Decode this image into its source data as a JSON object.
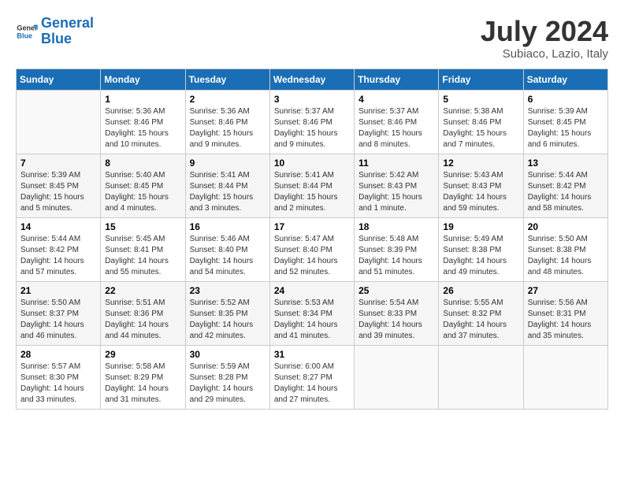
{
  "header": {
    "logo_line1": "General",
    "logo_line2": "Blue",
    "month_title": "July 2024",
    "location": "Subiaco, Lazio, Italy"
  },
  "columns": [
    "Sunday",
    "Monday",
    "Tuesday",
    "Wednesday",
    "Thursday",
    "Friday",
    "Saturday"
  ],
  "weeks": [
    [
      {
        "day": "",
        "sunrise": "",
        "sunset": "",
        "daylight": ""
      },
      {
        "day": "1",
        "sunrise": "Sunrise: 5:36 AM",
        "sunset": "Sunset: 8:46 PM",
        "daylight": "Daylight: 15 hours and 10 minutes."
      },
      {
        "day": "2",
        "sunrise": "Sunrise: 5:36 AM",
        "sunset": "Sunset: 8:46 PM",
        "daylight": "Daylight: 15 hours and 9 minutes."
      },
      {
        "day": "3",
        "sunrise": "Sunrise: 5:37 AM",
        "sunset": "Sunset: 8:46 PM",
        "daylight": "Daylight: 15 hours and 9 minutes."
      },
      {
        "day": "4",
        "sunrise": "Sunrise: 5:37 AM",
        "sunset": "Sunset: 8:46 PM",
        "daylight": "Daylight: 15 hours and 8 minutes."
      },
      {
        "day": "5",
        "sunrise": "Sunrise: 5:38 AM",
        "sunset": "Sunset: 8:46 PM",
        "daylight": "Daylight: 15 hours and 7 minutes."
      },
      {
        "day": "6",
        "sunrise": "Sunrise: 5:39 AM",
        "sunset": "Sunset: 8:45 PM",
        "daylight": "Daylight: 15 hours and 6 minutes."
      }
    ],
    [
      {
        "day": "7",
        "sunrise": "Sunrise: 5:39 AM",
        "sunset": "Sunset: 8:45 PM",
        "daylight": "Daylight: 15 hours and 5 minutes."
      },
      {
        "day": "8",
        "sunrise": "Sunrise: 5:40 AM",
        "sunset": "Sunset: 8:45 PM",
        "daylight": "Daylight: 15 hours and 4 minutes."
      },
      {
        "day": "9",
        "sunrise": "Sunrise: 5:41 AM",
        "sunset": "Sunset: 8:44 PM",
        "daylight": "Daylight: 15 hours and 3 minutes."
      },
      {
        "day": "10",
        "sunrise": "Sunrise: 5:41 AM",
        "sunset": "Sunset: 8:44 PM",
        "daylight": "Daylight: 15 hours and 2 minutes."
      },
      {
        "day": "11",
        "sunrise": "Sunrise: 5:42 AM",
        "sunset": "Sunset: 8:43 PM",
        "daylight": "Daylight: 15 hours and 1 minute."
      },
      {
        "day": "12",
        "sunrise": "Sunrise: 5:43 AM",
        "sunset": "Sunset: 8:43 PM",
        "daylight": "Daylight: 14 hours and 59 minutes."
      },
      {
        "day": "13",
        "sunrise": "Sunrise: 5:44 AM",
        "sunset": "Sunset: 8:42 PM",
        "daylight": "Daylight: 14 hours and 58 minutes."
      }
    ],
    [
      {
        "day": "14",
        "sunrise": "Sunrise: 5:44 AM",
        "sunset": "Sunset: 8:42 PM",
        "daylight": "Daylight: 14 hours and 57 minutes."
      },
      {
        "day": "15",
        "sunrise": "Sunrise: 5:45 AM",
        "sunset": "Sunset: 8:41 PM",
        "daylight": "Daylight: 14 hours and 55 minutes."
      },
      {
        "day": "16",
        "sunrise": "Sunrise: 5:46 AM",
        "sunset": "Sunset: 8:40 PM",
        "daylight": "Daylight: 14 hours and 54 minutes."
      },
      {
        "day": "17",
        "sunrise": "Sunrise: 5:47 AM",
        "sunset": "Sunset: 8:40 PM",
        "daylight": "Daylight: 14 hours and 52 minutes."
      },
      {
        "day": "18",
        "sunrise": "Sunrise: 5:48 AM",
        "sunset": "Sunset: 8:39 PM",
        "daylight": "Daylight: 14 hours and 51 minutes."
      },
      {
        "day": "19",
        "sunrise": "Sunrise: 5:49 AM",
        "sunset": "Sunset: 8:38 PM",
        "daylight": "Daylight: 14 hours and 49 minutes."
      },
      {
        "day": "20",
        "sunrise": "Sunrise: 5:50 AM",
        "sunset": "Sunset: 8:38 PM",
        "daylight": "Daylight: 14 hours and 48 minutes."
      }
    ],
    [
      {
        "day": "21",
        "sunrise": "Sunrise: 5:50 AM",
        "sunset": "Sunset: 8:37 PM",
        "daylight": "Daylight: 14 hours and 46 minutes."
      },
      {
        "day": "22",
        "sunrise": "Sunrise: 5:51 AM",
        "sunset": "Sunset: 8:36 PM",
        "daylight": "Daylight: 14 hours and 44 minutes."
      },
      {
        "day": "23",
        "sunrise": "Sunrise: 5:52 AM",
        "sunset": "Sunset: 8:35 PM",
        "daylight": "Daylight: 14 hours and 42 minutes."
      },
      {
        "day": "24",
        "sunrise": "Sunrise: 5:53 AM",
        "sunset": "Sunset: 8:34 PM",
        "daylight": "Daylight: 14 hours and 41 minutes."
      },
      {
        "day": "25",
        "sunrise": "Sunrise: 5:54 AM",
        "sunset": "Sunset: 8:33 PM",
        "daylight": "Daylight: 14 hours and 39 minutes."
      },
      {
        "day": "26",
        "sunrise": "Sunrise: 5:55 AM",
        "sunset": "Sunset: 8:32 PM",
        "daylight": "Daylight: 14 hours and 37 minutes."
      },
      {
        "day": "27",
        "sunrise": "Sunrise: 5:56 AM",
        "sunset": "Sunset: 8:31 PM",
        "daylight": "Daylight: 14 hours and 35 minutes."
      }
    ],
    [
      {
        "day": "28",
        "sunrise": "Sunrise: 5:57 AM",
        "sunset": "Sunset: 8:30 PM",
        "daylight": "Daylight: 14 hours and 33 minutes."
      },
      {
        "day": "29",
        "sunrise": "Sunrise: 5:58 AM",
        "sunset": "Sunset: 8:29 PM",
        "daylight": "Daylight: 14 hours and 31 minutes."
      },
      {
        "day": "30",
        "sunrise": "Sunrise: 5:59 AM",
        "sunset": "Sunset: 8:28 PM",
        "daylight": "Daylight: 14 hours and 29 minutes."
      },
      {
        "day": "31",
        "sunrise": "Sunrise: 6:00 AM",
        "sunset": "Sunset: 8:27 PM",
        "daylight": "Daylight: 14 hours and 27 minutes."
      },
      {
        "day": "",
        "sunrise": "",
        "sunset": "",
        "daylight": ""
      },
      {
        "day": "",
        "sunrise": "",
        "sunset": "",
        "daylight": ""
      },
      {
        "day": "",
        "sunrise": "",
        "sunset": "",
        "daylight": ""
      }
    ]
  ]
}
